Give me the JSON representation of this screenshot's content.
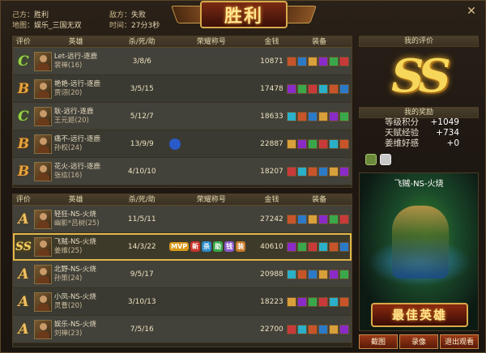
{
  "header": {
    "our_side_label": "己方：",
    "our_side_value": "胜利",
    "enemy_side_label": "敌方：",
    "enemy_side_value": "失败",
    "map_label": "地图：",
    "map_value": "娱乐_三国无双",
    "time_label": "时间：",
    "time_value": "27分3秒",
    "banner": "胜利"
  },
  "columns": {
    "rating": "评价",
    "hero": "英雄",
    "kda": "杀/死/助",
    "honor": "荣耀称号",
    "gold": "金钱",
    "equip": "装备"
  },
  "team_a": [
    {
      "grade": "C",
      "player": "Let-远行-逐鹿",
      "hero": "裴禅(16)",
      "kda": "3/8/6",
      "gold": "10871",
      "honor": []
    },
    {
      "grade": "B",
      "player": "艳艳-远行-逐鹿",
      "hero": "贾诩(20)",
      "kda": "3/5/15",
      "gold": "17478",
      "honor": []
    },
    {
      "grade": "C",
      "player": "耿-远行-逐鹿",
      "hero": "王元姬(20)",
      "kda": "5/12/7",
      "gold": "18633",
      "honor": []
    },
    {
      "grade": "B",
      "player": "痛不-远行-逐鹿",
      "hero": "孙权(24)",
      "kda": "13/9/9",
      "gold": "22887",
      "honor": [
        "badge-blue"
      ]
    },
    {
      "grade": "B",
      "player": "花火-远行-逐鹿",
      "hero": "张纮(16)",
      "kda": "4/10/10",
      "gold": "18207",
      "honor": []
    }
  ],
  "team_b": [
    {
      "grade": "A",
      "player": "轻狂-NS-火烧",
      "hero": "幽影*吕树(25)",
      "kda": "11/5/11",
      "gold": "27242",
      "honor": [],
      "highlight": false
    },
    {
      "grade": "SS",
      "player": "飞贼-NS-火烧",
      "hero": "姜维(25)",
      "kda": "14/3/22",
      "gold": "40610",
      "honor": [
        "MVP",
        "新",
        "杀",
        "助",
        "钱",
        "装"
      ],
      "highlight": true
    },
    {
      "grade": "A",
      "player": "北野-NS-火烧",
      "hero": "孙策(24)",
      "kda": "9/5/17",
      "gold": "20988",
      "honor": [],
      "highlight": false
    },
    {
      "grade": "A",
      "player": "小凤-NS-火烧",
      "hero": "灵曹(20)",
      "kda": "3/10/13",
      "gold": "18223",
      "honor": [],
      "highlight": false
    },
    {
      "grade": "A",
      "player": "娱乐-NS-火烧",
      "hero": "刘禅(23)",
      "kda": "7/5/16",
      "gold": "22700",
      "honor": [],
      "highlight": false
    }
  ],
  "my_rating": {
    "title": "我的评价",
    "grade": "SS"
  },
  "my_rewards": {
    "title": "我的奖励",
    "items": [
      {
        "label": "等级积分",
        "value": "+1049"
      },
      {
        "label": "天赋经验",
        "value": "+734"
      },
      {
        "label": "姜维好感",
        "value": "+0"
      }
    ]
  },
  "mvp": {
    "name": "飞贼-NS-火烧",
    "label": "最佳英雄"
  },
  "buttons": {
    "screenshot": "截图",
    "replay": "录像",
    "exit": "退出观看"
  },
  "colors": {
    "gold_accent": "#e1b64a",
    "grade_c": "#9bd44a",
    "grade_b": "#e8a43a",
    "grade_a": "#f0c060"
  }
}
